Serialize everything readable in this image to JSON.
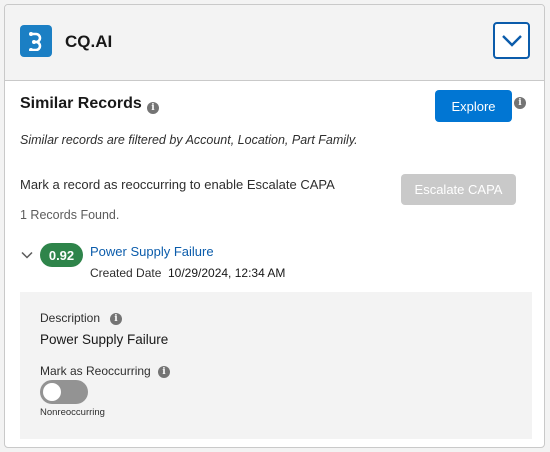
{
  "header": {
    "app_title": "CQ.AI",
    "app_icon": "cq-ai-logo-icon",
    "collapse_icon": "chevron-down-icon",
    "accent_color": "#0176d3"
  },
  "similar_records": {
    "title": "Similar Records",
    "info_icon": "info-icon",
    "explore_label": "Explore",
    "filter_note": "Similar records are filtered by Account, Location, Part Family.",
    "mark_note": "Mark a record as reoccurring to enable Escalate CAPA",
    "escalate_label": "Escalate CAPA",
    "records_found": "1 Records Found."
  },
  "record": {
    "score": "0.92",
    "score_color": "#2e844a",
    "name": "Power Supply Failure",
    "created_label": "Created Date",
    "created_value": "10/29/2024, 12:34 AM",
    "expanded": true,
    "details": {
      "description_label": "Description",
      "description_value": "Power Supply Failure",
      "reoccurring_label": "Mark as Reoccurring",
      "reoccurring_on": false,
      "reoccurring_state_text": "Nonreoccurring"
    }
  }
}
